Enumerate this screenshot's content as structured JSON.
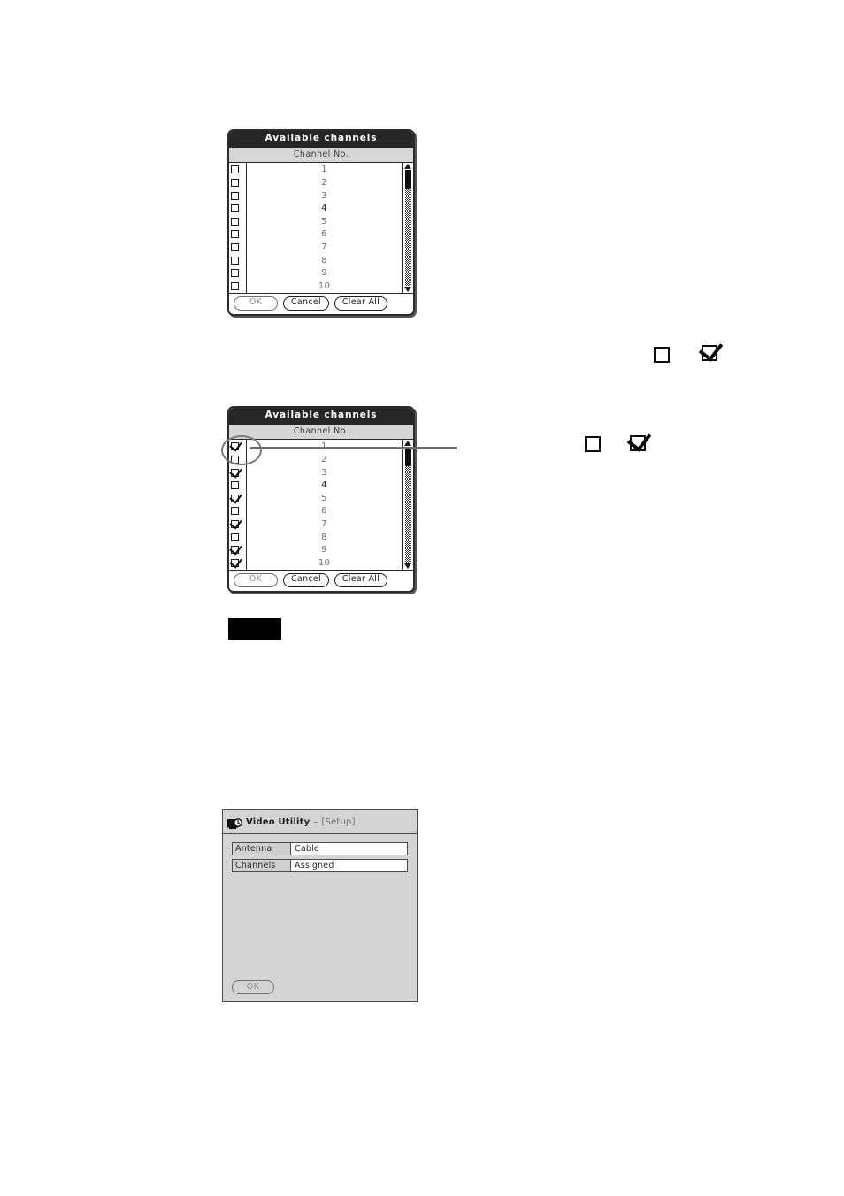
{
  "dialog_unchecked": {
    "title": "Available channels",
    "column_header": "Channel No.",
    "rows": [
      {
        "num": "1",
        "checked": false
      },
      {
        "num": "2",
        "checked": false
      },
      {
        "num": "3",
        "checked": false
      },
      {
        "num": "4",
        "checked": false
      },
      {
        "num": "5",
        "checked": false
      },
      {
        "num": "6",
        "checked": false
      },
      {
        "num": "7",
        "checked": false
      },
      {
        "num": "8",
        "checked": false
      },
      {
        "num": "9",
        "checked": false
      },
      {
        "num": "10",
        "checked": false
      }
    ],
    "buttons": {
      "ok": "OK",
      "cancel": "Cancel",
      "clear_all": "Clear All"
    },
    "scrollbar": {
      "up_arrow_icon": "triangle-up-icon",
      "down_arrow_icon": "triangle-down-icon",
      "thumb_position": "top"
    }
  },
  "dialog_checked": {
    "title": "Available channels",
    "column_header": "Channel No.",
    "rows": [
      {
        "num": "1",
        "checked": true
      },
      {
        "num": "2",
        "checked": false
      },
      {
        "num": "3",
        "checked": true
      },
      {
        "num": "4",
        "checked": false
      },
      {
        "num": "5",
        "checked": true
      },
      {
        "num": "6",
        "checked": false
      },
      {
        "num": "7",
        "checked": true
      },
      {
        "num": "8",
        "checked": false
      },
      {
        "num": "9",
        "checked": true
      },
      {
        "num": "10",
        "checked": true
      }
    ],
    "buttons": {
      "ok": "OK",
      "cancel": "Cancel",
      "clear_all": "Clear All"
    },
    "scrollbar": {
      "up_arrow_icon": "triangle-up-icon",
      "down_arrow_icon": "triangle-down-icon",
      "thumb_position": "top"
    },
    "annotation": {
      "shape": "ellipse-callout",
      "target": "first-row-checkbox",
      "leader_line": true
    }
  },
  "legend_top": {
    "unchecked_icon": "checkbox-empty-icon",
    "checked_icon": "checkbox-checked-icon"
  },
  "legend_bottom": {
    "unchecked_icon": "checkbox-empty-icon",
    "checked_icon": "checkbox-checked-icon"
  },
  "redaction_block": {
    "color": "#000000"
  },
  "video_utility": {
    "icon": "video-utility-icon",
    "title": "Video Utility",
    "separator": "–",
    "subtitle": "[Setup]",
    "fields": [
      {
        "label": "Antenna",
        "value": "Cable"
      },
      {
        "label": "Channels",
        "value": "Assigned"
      }
    ],
    "ok_button": "OK"
  },
  "colors": {
    "titlebar_bg": "#262626",
    "colhead_bg": "#d6d6d6",
    "window_bg": "#d4d4d4",
    "border": "#2b2b2b",
    "annotation": "#7a7a7a",
    "disabled_text": "#8d8d8d"
  }
}
